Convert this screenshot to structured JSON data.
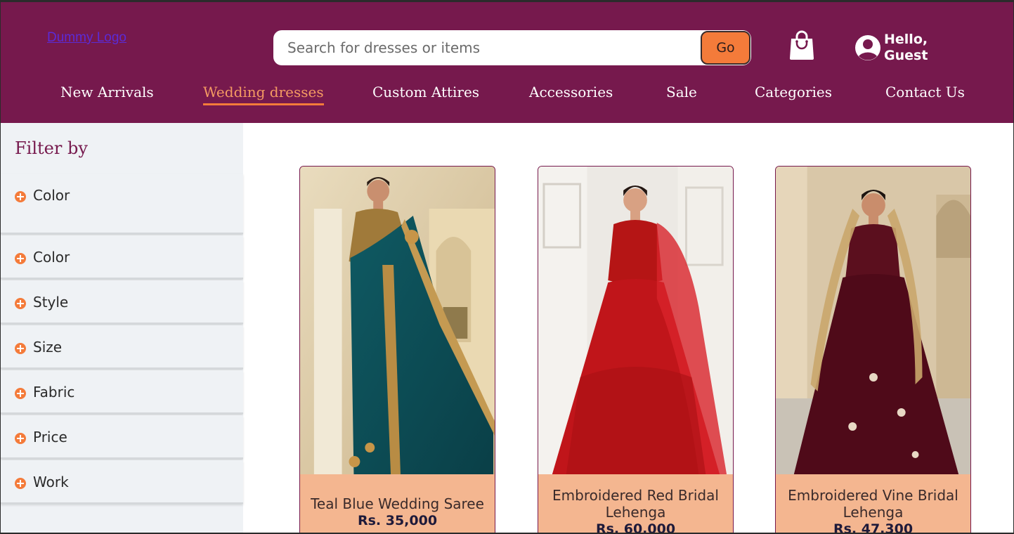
{
  "header": {
    "logo": "Dummy Logo",
    "search_placeholder": "Search for dresses or items",
    "go_label": "Go",
    "greeting_line1": "Hello,",
    "greeting_line2": "Guest",
    "background": "#76194d",
    "accent": "#f47b3a"
  },
  "nav": {
    "items": [
      "New Arrivals",
      "Wedding dresses",
      "Custom Attires",
      "Accessories",
      "Sale",
      "Categories",
      "Contact Us"
    ],
    "active": "Wedding dresses"
  },
  "sidebar": {
    "title": "Filter by",
    "filters": [
      "Color",
      "Color",
      "Style",
      "Size",
      "Fabric",
      "Price",
      "Work"
    ]
  },
  "products": [
    {
      "name": "Teal Blue Wedding Saree",
      "price": "Rs. 35,000",
      "image": "teal-saree-image"
    },
    {
      "name": "Embroidered Red Bridal Lehenga",
      "price": "Rs. 60,000",
      "image": "red-lehenga-image"
    },
    {
      "name": "Embroidered Vine Bridal Lehenga",
      "price": "Rs. 47,300",
      "image": "vine-lehenga-image"
    }
  ]
}
